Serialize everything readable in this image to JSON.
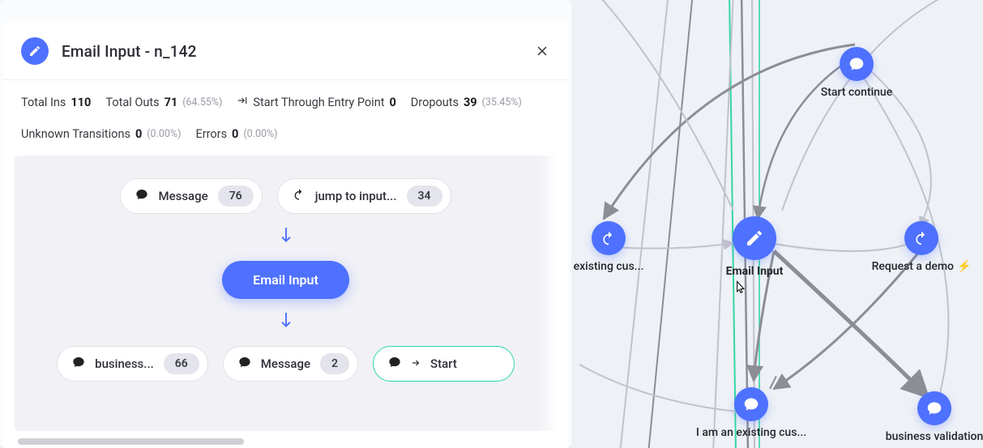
{
  "header": {
    "title": "Email Input - n_142"
  },
  "stats": {
    "totalIns": {
      "label": "Total Ins",
      "value": "110"
    },
    "totalOuts": {
      "label": "Total Outs",
      "value": "71",
      "pct": "(64.55%)"
    },
    "startEntry": {
      "label": "Start Through Entry Point",
      "value": "0"
    },
    "dropouts": {
      "label": "Dropouts",
      "value": "39",
      "pct": "(35.45%)"
    },
    "unknown": {
      "label": "Unknown Transitions",
      "value": "0",
      "pct": "(0.00%)"
    },
    "errors": {
      "label": "Errors",
      "value": "0",
      "pct": "(0.00%)"
    }
  },
  "flow": {
    "inputs": [
      {
        "icon": "chat",
        "label": "Message",
        "count": "76"
      },
      {
        "icon": "redo",
        "label": "jump to input...",
        "count": "34"
      }
    ],
    "center": {
      "label": "Email Input"
    },
    "outputs": [
      {
        "icon": "chat",
        "label": "business...",
        "count": "66",
        "style": "default"
      },
      {
        "icon": "chat",
        "label": "Message",
        "count": "2",
        "style": "default"
      },
      {
        "icon": "chat",
        "label": "Start",
        "count": "",
        "style": "green",
        "arrow": true
      }
    ]
  },
  "graph": {
    "nodes": {
      "startContinue": {
        "icon": "chat",
        "label": "Start continue"
      },
      "existingCus": {
        "icon": "redo",
        "label": "existing cus..."
      },
      "emailInput": {
        "icon": "pencil",
        "label": "Email Input"
      },
      "requestDemo": {
        "icon": "redo",
        "label": "Request a demo",
        "emoji": "⚡"
      },
      "iamExisting": {
        "icon": "chat",
        "label": "I am an existing cus..."
      },
      "bizValidation": {
        "icon": "chat",
        "label": "business validation"
      }
    }
  }
}
